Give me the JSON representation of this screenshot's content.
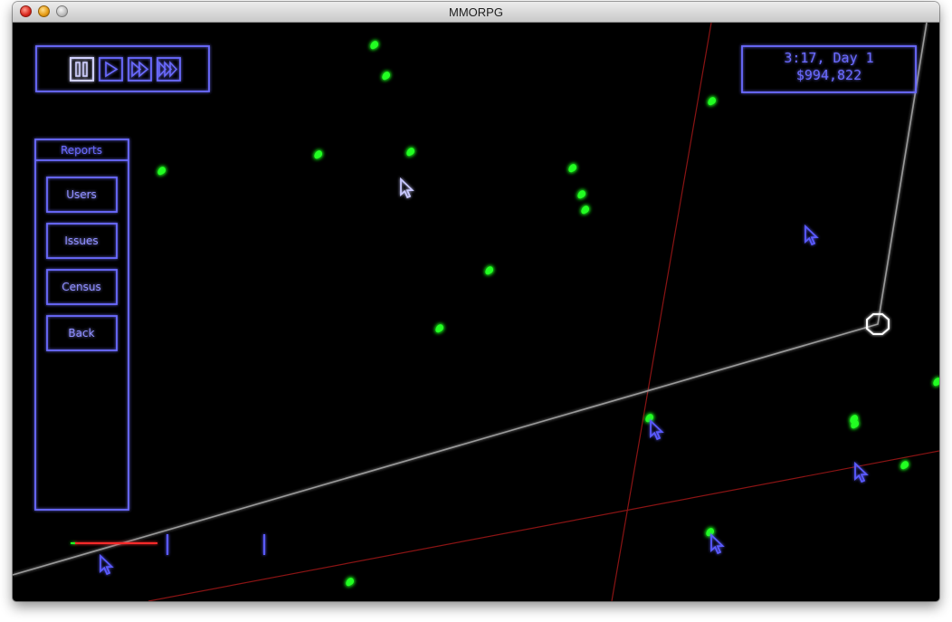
{
  "window": {
    "title": "MMORPG"
  },
  "controls": {
    "buttons": [
      {
        "icon": "pause-icon",
        "active": true
      },
      {
        "icon": "play-icon",
        "active": false
      },
      {
        "icon": "fast-forward-icon",
        "active": false
      },
      {
        "icon": "fastest-forward-icon",
        "active": false
      }
    ]
  },
  "hud": {
    "time": "3:17, Day 1",
    "money": "$994,822"
  },
  "reports": {
    "title": "Reports",
    "items": [
      {
        "label": "Users"
      },
      {
        "label": "Issues"
      },
      {
        "label": "Census"
      },
      {
        "label": "Back"
      }
    ]
  },
  "colors": {
    "neon_blue": "#6b6bff",
    "player_green": "#22ff22",
    "path_gray": "#9a9a9a",
    "grid_red": "#a31818",
    "background": "#000000"
  }
}
